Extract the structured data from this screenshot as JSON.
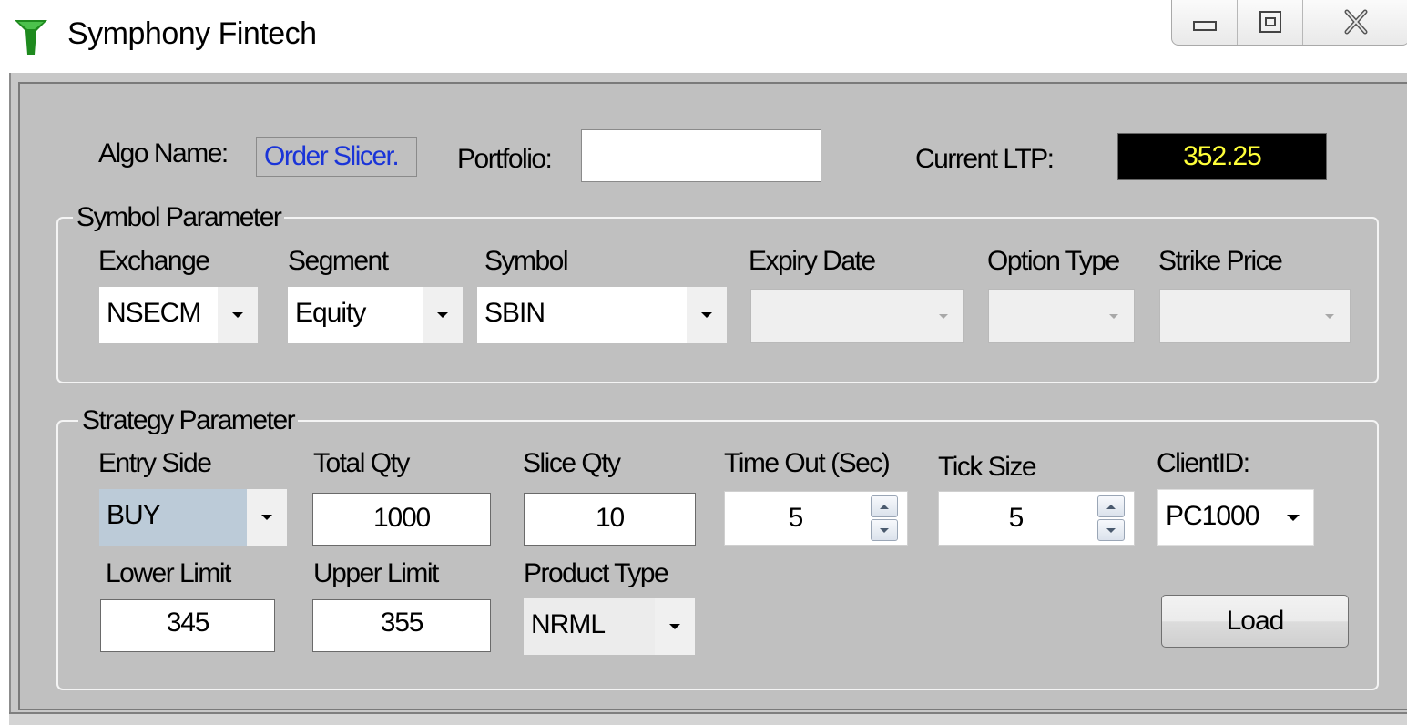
{
  "window": {
    "title": "Symphony Fintech",
    "logo_color": "#1e8a1e"
  },
  "header": {
    "algo_name_label": "Algo Name:",
    "algo_name_value": "Order Slicer.",
    "portfolio_label": "Portfolio:",
    "portfolio_value": "",
    "ltp_label": "Current LTP:",
    "ltp_value": "352.25",
    "ltp_color": "#ffff39"
  },
  "symbol_parameter": {
    "legend": "Symbol Parameter",
    "exchange": {
      "label": "Exchange",
      "value": "NSECM"
    },
    "segment": {
      "label": "Segment",
      "value": "Equity"
    },
    "symbol": {
      "label": "Symbol",
      "value": "SBIN"
    },
    "expiry_date": {
      "label": "Expiry Date",
      "value": ""
    },
    "option_type": {
      "label": "Option Type",
      "value": ""
    },
    "strike_price": {
      "label": "Strike Price",
      "value": ""
    }
  },
  "strategy_parameter": {
    "legend": "Strategy Parameter",
    "entry_side": {
      "label": "Entry Side",
      "value": "BUY",
      "highlight_color": "#bccbd8"
    },
    "total_qty": {
      "label": "Total Qty",
      "value": "1000"
    },
    "slice_qty": {
      "label": "Slice Qty",
      "value": "10"
    },
    "time_out": {
      "label": "Time Out (Sec)",
      "value": "5"
    },
    "tick_size": {
      "label": "Tick Size",
      "value": "5"
    },
    "client_id": {
      "label": "ClientID:",
      "value": "PC1000"
    },
    "lower_limit": {
      "label": "Lower Limit",
      "value": "345"
    },
    "upper_limit": {
      "label": "Upper Limit",
      "value": "355"
    },
    "product_type": {
      "label": "Product Type",
      "value": "NRML"
    },
    "load_button": "Load"
  }
}
